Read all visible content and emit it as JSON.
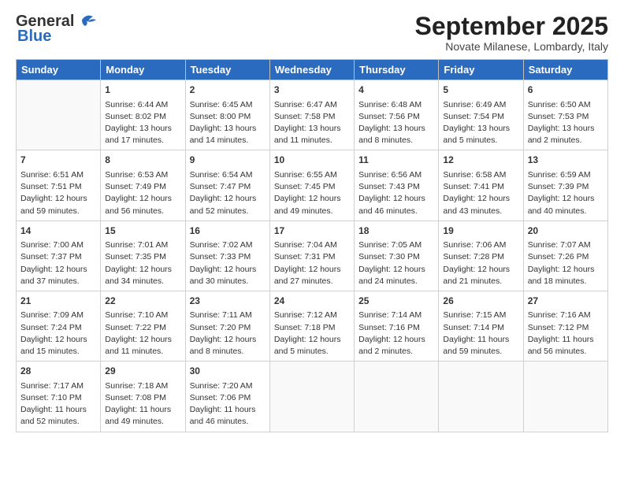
{
  "header": {
    "logo_line1": "General",
    "logo_line2": "Blue",
    "month_title": "September 2025",
    "location": "Novate Milanese, Lombardy, Italy"
  },
  "days_of_week": [
    "Sunday",
    "Monday",
    "Tuesday",
    "Wednesday",
    "Thursday",
    "Friday",
    "Saturday"
  ],
  "weeks": [
    [
      {
        "day": "",
        "sunrise": "",
        "sunset": "",
        "daylight": ""
      },
      {
        "day": "1",
        "sunrise": "Sunrise: 6:44 AM",
        "sunset": "Sunset: 8:02 PM",
        "daylight": "Daylight: 13 hours and 17 minutes."
      },
      {
        "day": "2",
        "sunrise": "Sunrise: 6:45 AM",
        "sunset": "Sunset: 8:00 PM",
        "daylight": "Daylight: 13 hours and 14 minutes."
      },
      {
        "day": "3",
        "sunrise": "Sunrise: 6:47 AM",
        "sunset": "Sunset: 7:58 PM",
        "daylight": "Daylight: 13 hours and 11 minutes."
      },
      {
        "day": "4",
        "sunrise": "Sunrise: 6:48 AM",
        "sunset": "Sunset: 7:56 PM",
        "daylight": "Daylight: 13 hours and 8 minutes."
      },
      {
        "day": "5",
        "sunrise": "Sunrise: 6:49 AM",
        "sunset": "Sunset: 7:54 PM",
        "daylight": "Daylight: 13 hours and 5 minutes."
      },
      {
        "day": "6",
        "sunrise": "Sunrise: 6:50 AM",
        "sunset": "Sunset: 7:53 PM",
        "daylight": "Daylight: 13 hours and 2 minutes."
      }
    ],
    [
      {
        "day": "7",
        "sunrise": "Sunrise: 6:51 AM",
        "sunset": "Sunset: 7:51 PM",
        "daylight": "Daylight: 12 hours and 59 minutes."
      },
      {
        "day": "8",
        "sunrise": "Sunrise: 6:53 AM",
        "sunset": "Sunset: 7:49 PM",
        "daylight": "Daylight: 12 hours and 56 minutes."
      },
      {
        "day": "9",
        "sunrise": "Sunrise: 6:54 AM",
        "sunset": "Sunset: 7:47 PM",
        "daylight": "Daylight: 12 hours and 52 minutes."
      },
      {
        "day": "10",
        "sunrise": "Sunrise: 6:55 AM",
        "sunset": "Sunset: 7:45 PM",
        "daylight": "Daylight: 12 hours and 49 minutes."
      },
      {
        "day": "11",
        "sunrise": "Sunrise: 6:56 AM",
        "sunset": "Sunset: 7:43 PM",
        "daylight": "Daylight: 12 hours and 46 minutes."
      },
      {
        "day": "12",
        "sunrise": "Sunrise: 6:58 AM",
        "sunset": "Sunset: 7:41 PM",
        "daylight": "Daylight: 12 hours and 43 minutes."
      },
      {
        "day": "13",
        "sunrise": "Sunrise: 6:59 AM",
        "sunset": "Sunset: 7:39 PM",
        "daylight": "Daylight: 12 hours and 40 minutes."
      }
    ],
    [
      {
        "day": "14",
        "sunrise": "Sunrise: 7:00 AM",
        "sunset": "Sunset: 7:37 PM",
        "daylight": "Daylight: 12 hours and 37 minutes."
      },
      {
        "day": "15",
        "sunrise": "Sunrise: 7:01 AM",
        "sunset": "Sunset: 7:35 PM",
        "daylight": "Daylight: 12 hours and 34 minutes."
      },
      {
        "day": "16",
        "sunrise": "Sunrise: 7:02 AM",
        "sunset": "Sunset: 7:33 PM",
        "daylight": "Daylight: 12 hours and 30 minutes."
      },
      {
        "day": "17",
        "sunrise": "Sunrise: 7:04 AM",
        "sunset": "Sunset: 7:31 PM",
        "daylight": "Daylight: 12 hours and 27 minutes."
      },
      {
        "day": "18",
        "sunrise": "Sunrise: 7:05 AM",
        "sunset": "Sunset: 7:30 PM",
        "daylight": "Daylight: 12 hours and 24 minutes."
      },
      {
        "day": "19",
        "sunrise": "Sunrise: 7:06 AM",
        "sunset": "Sunset: 7:28 PM",
        "daylight": "Daylight: 12 hours and 21 minutes."
      },
      {
        "day": "20",
        "sunrise": "Sunrise: 7:07 AM",
        "sunset": "Sunset: 7:26 PM",
        "daylight": "Daylight: 12 hours and 18 minutes."
      }
    ],
    [
      {
        "day": "21",
        "sunrise": "Sunrise: 7:09 AM",
        "sunset": "Sunset: 7:24 PM",
        "daylight": "Daylight: 12 hours and 15 minutes."
      },
      {
        "day": "22",
        "sunrise": "Sunrise: 7:10 AM",
        "sunset": "Sunset: 7:22 PM",
        "daylight": "Daylight: 12 hours and 11 minutes."
      },
      {
        "day": "23",
        "sunrise": "Sunrise: 7:11 AM",
        "sunset": "Sunset: 7:20 PM",
        "daylight": "Daylight: 12 hours and 8 minutes."
      },
      {
        "day": "24",
        "sunrise": "Sunrise: 7:12 AM",
        "sunset": "Sunset: 7:18 PM",
        "daylight": "Daylight: 12 hours and 5 minutes."
      },
      {
        "day": "25",
        "sunrise": "Sunrise: 7:14 AM",
        "sunset": "Sunset: 7:16 PM",
        "daylight": "Daylight: 12 hours and 2 minutes."
      },
      {
        "day": "26",
        "sunrise": "Sunrise: 7:15 AM",
        "sunset": "Sunset: 7:14 PM",
        "daylight": "Daylight: 11 hours and 59 minutes."
      },
      {
        "day": "27",
        "sunrise": "Sunrise: 7:16 AM",
        "sunset": "Sunset: 7:12 PM",
        "daylight": "Daylight: 11 hours and 56 minutes."
      }
    ],
    [
      {
        "day": "28",
        "sunrise": "Sunrise: 7:17 AM",
        "sunset": "Sunset: 7:10 PM",
        "daylight": "Daylight: 11 hours and 52 minutes."
      },
      {
        "day": "29",
        "sunrise": "Sunrise: 7:18 AM",
        "sunset": "Sunset: 7:08 PM",
        "daylight": "Daylight: 11 hours and 49 minutes."
      },
      {
        "day": "30",
        "sunrise": "Sunrise: 7:20 AM",
        "sunset": "Sunset: 7:06 PM",
        "daylight": "Daylight: 11 hours and 46 minutes."
      },
      {
        "day": "",
        "sunrise": "",
        "sunset": "",
        "daylight": ""
      },
      {
        "day": "",
        "sunrise": "",
        "sunset": "",
        "daylight": ""
      },
      {
        "day": "",
        "sunrise": "",
        "sunset": "",
        "daylight": ""
      },
      {
        "day": "",
        "sunrise": "",
        "sunset": "",
        "daylight": ""
      }
    ]
  ]
}
